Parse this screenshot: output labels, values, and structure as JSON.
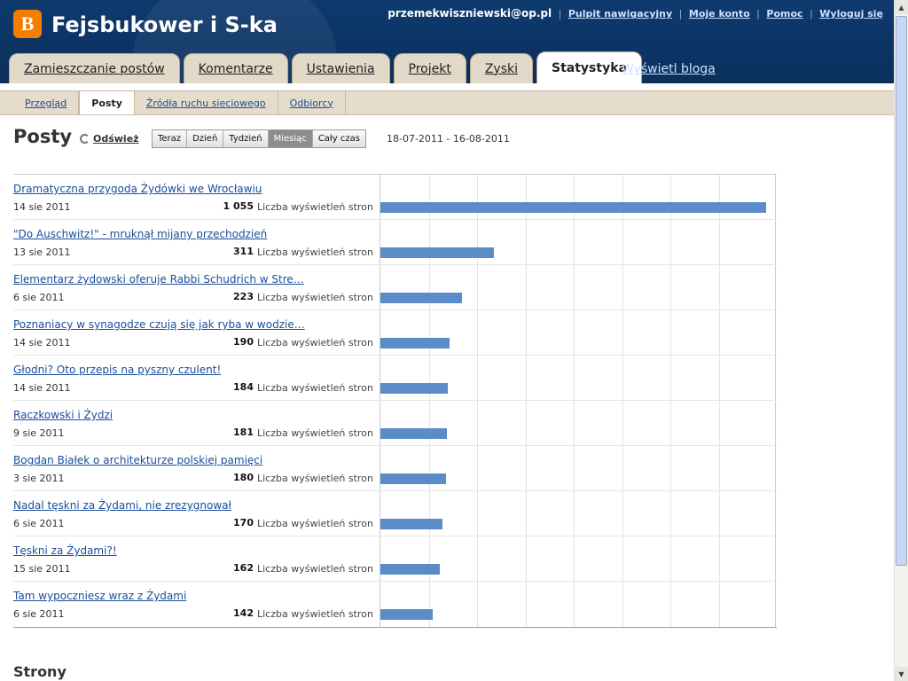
{
  "header": {
    "logo_letter": "B",
    "blog_title": "Fejsbukower i S-ka",
    "user_email": "przemekwiszniewski@op.pl",
    "links": [
      "Pulpit nawigacyjny",
      "Moje konto",
      "Pomoc",
      "Wyloguj się"
    ]
  },
  "tabs": [
    "Zamieszczanie postów",
    "Komentarze",
    "Ustawienia",
    "Projekt",
    "Zyski",
    "Statystyka"
  ],
  "active_tab": "Statystyka",
  "view_blog": "Wyświetl bloga",
  "subtabs": [
    "Przegląd",
    "Posty",
    "Źródła ruchu sieciowego",
    "Odbiorcy"
  ],
  "active_subtab": "Posty",
  "page": {
    "title": "Posty",
    "refresh": "Odśwież",
    "ranges": [
      "Teraz",
      "Dzień",
      "Tydzień",
      "Miesiąc",
      "Cały czas"
    ],
    "active_range": "Miesiąc",
    "date_range": "18-07-2011 - 16-08-2011",
    "views_label": "Liczba wyświetleń stron",
    "pages_heading": "Strony"
  },
  "posts": [
    {
      "title": "Dramatyczna przygoda Żydówki we Wrocławiu",
      "date": "14 sie 2011",
      "views": "1 055",
      "value": 1055
    },
    {
      "title": "\"Do Auschwitz!\" - mruknął mijany przechodzień",
      "date": "13 sie 2011",
      "views": "311",
      "value": 311
    },
    {
      "title": "Elementarz żydowski oferuje Rabbi Schudrich w Stre…",
      "date": "6 sie 2011",
      "views": "223",
      "value": 223
    },
    {
      "title": "Poznaniacy w synagodze czują się jak ryba w wodzie…",
      "date": "14 sie 2011",
      "views": "190",
      "value": 190
    },
    {
      "title": "Głodni? Oto przepis na pyszny czulent!",
      "date": "14 sie 2011",
      "views": "184",
      "value": 184
    },
    {
      "title": "Raczkowski i Żydzi",
      "date": "9 sie 2011",
      "views": "181",
      "value": 181
    },
    {
      "title": "Bogdan Białek o architekturze polskiej pamięci",
      "date": "3 sie 2011",
      "views": "180",
      "value": 180
    },
    {
      "title": "Nadal tęskni za Żydami, nie zrezygnował",
      "date": "6 sie 2011",
      "views": "170",
      "value": 170
    },
    {
      "title": "Tęskni za Żydami?!",
      "date": "15 sie 2011",
      "views": "162",
      "value": 162
    },
    {
      "title": "Tam wypoczniesz wraz z Żydami",
      "date": "6 sie 2011",
      "views": "142",
      "value": 142
    }
  ],
  "colors": {
    "bar": "#5b8cc7",
    "header": "#0e3a6e",
    "logo": "#f57d00",
    "tab": "#e3d9c9"
  },
  "icons": {
    "logo": "blogger-logo-icon",
    "refresh": "refresh-icon",
    "scroll_up": "scroll-up-arrow-icon",
    "scroll_down": "scroll-down-arrow-icon"
  }
}
